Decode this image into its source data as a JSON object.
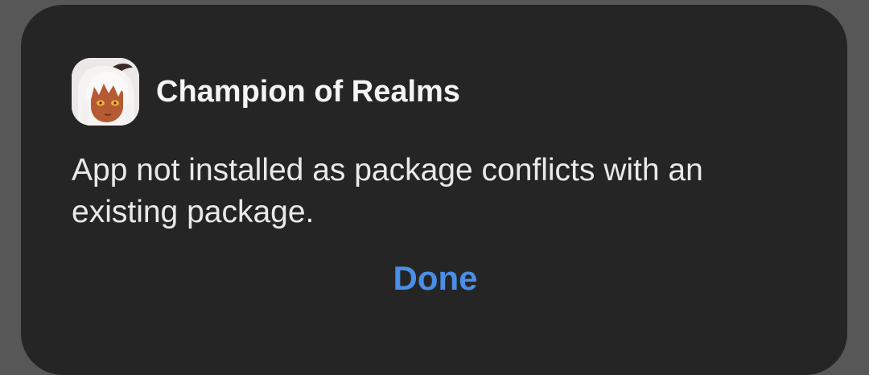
{
  "dialog": {
    "app_name": "Champion of Realms",
    "app_icon": "anime-character-avatar-icon",
    "message": "App not installed as package conflicts with an existing package.",
    "done_label": "Done"
  },
  "colors": {
    "scrim": "#575757",
    "dialog_background": "#252525",
    "accent": "#4a8ee6"
  }
}
